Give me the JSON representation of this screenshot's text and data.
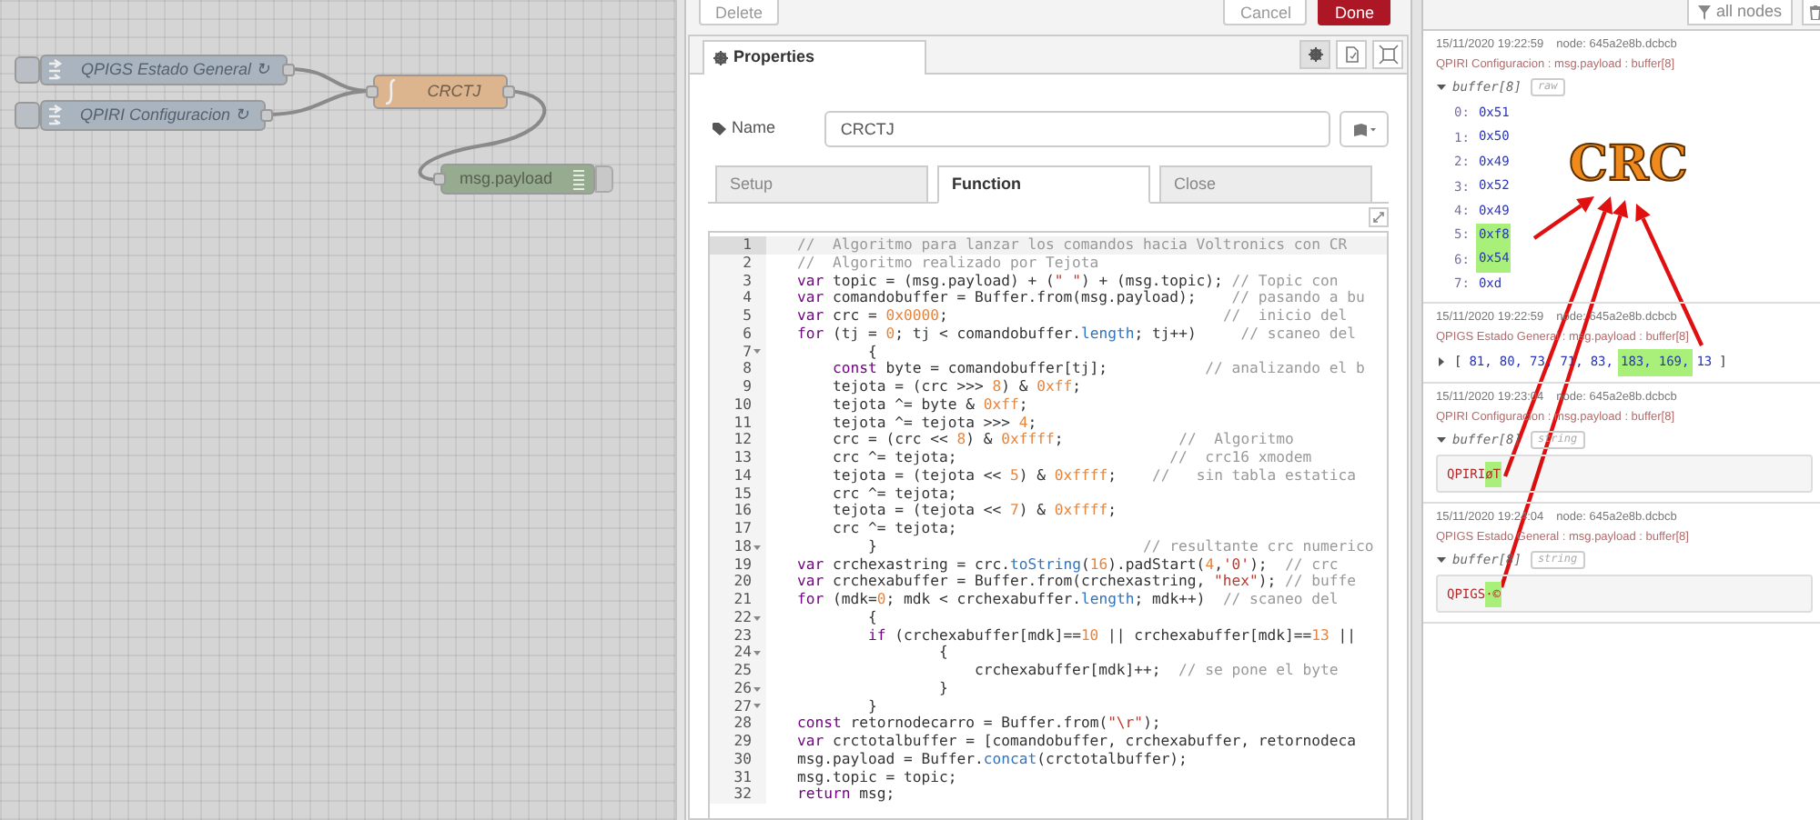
{
  "canvas": {
    "nodes": [
      {
        "kind": "inject",
        "label": "QPIGS Estado General ↻"
      },
      {
        "kind": "inject",
        "label": "QPIRI Configuracion ↻"
      },
      {
        "kind": "function",
        "label": "CRCTJ"
      },
      {
        "kind": "debug",
        "label": "msg.payload"
      }
    ]
  },
  "editor": {
    "buttons": [
      {
        "kind": "plain",
        "label": "Delete"
      },
      {
        "kind": "plain",
        "label": "Cancel"
      },
      {
        "kind": "primary",
        "label": "Done"
      }
    ],
    "panel_tab": "Properties",
    "panel_icons": [
      {
        "kind": "gear",
        "selected": true
      },
      {
        "kind": "document",
        "selected": false
      },
      {
        "kind": "frame",
        "selected": false
      }
    ],
    "name_label": "Name",
    "name_value": "CRCTJ",
    "tabs": [
      {
        "label": "Setup",
        "selected": false
      },
      {
        "label": "Function",
        "selected": true
      },
      {
        "label": "Close",
        "selected": false
      }
    ],
    "code_lines": [
      {
        "number": "1",
        "active": true,
        "foldable": false,
        "segments": [
          {
            "kind": "comment",
            "text": "//  Algoritmo para lanzar los comandos hacia Voltronics con CR"
          }
        ]
      },
      {
        "number": "2",
        "active": false,
        "foldable": false,
        "segments": [
          {
            "kind": "comment",
            "text": "//  Algoritmo realizado por Tejota"
          }
        ]
      },
      {
        "number": "3",
        "active": false,
        "foldable": false,
        "segments": [
          {
            "kind": "keyword",
            "text": "var"
          },
          {
            "text": " topic = (msg.payload) + ("
          },
          {
            "kind": "string",
            "text": "\" \""
          },
          {
            "text": ") + (msg.topic); "
          },
          {
            "kind": "comment",
            "text": "// Topic con"
          }
        ]
      },
      {
        "number": "4",
        "active": false,
        "foldable": false,
        "segments": [
          {
            "kind": "keyword",
            "text": "var"
          },
          {
            "text": " comandobuffer = Buffer.from(msg.payload);    "
          },
          {
            "kind": "comment",
            "text": "// pasando a bu"
          }
        ]
      },
      {
        "number": "5",
        "active": false,
        "foldable": false,
        "segments": [
          {
            "kind": "keyword",
            "text": "var"
          },
          {
            "text": " crc = "
          },
          {
            "kind": "number",
            "text": "0x0000"
          },
          {
            "text": ";                               "
          },
          {
            "kind": "comment",
            "text": "//  inicio del"
          }
        ]
      },
      {
        "number": "6",
        "active": false,
        "foldable": false,
        "segments": [
          {
            "kind": "keyword",
            "text": "for"
          },
          {
            "text": " (tj = "
          },
          {
            "kind": "number",
            "text": "0"
          },
          {
            "text": "; tj < comandobuffer."
          },
          {
            "kind": "property",
            "text": "length"
          },
          {
            "text": "; tj++)     "
          },
          {
            "kind": "comment",
            "text": "// scaneo del"
          }
        ]
      },
      {
        "number": "7",
        "active": false,
        "foldable": true,
        "segments": [
          {
            "text": "        {"
          }
        ]
      },
      {
        "number": "8",
        "active": false,
        "foldable": false,
        "segments": [
          {
            "kind": "keyword",
            "text": "    const"
          },
          {
            "text": " byte = comandobuffer[tj];           "
          },
          {
            "kind": "comment",
            "text": "// analizando el b"
          }
        ]
      },
      {
        "number": "9",
        "active": false,
        "foldable": false,
        "segments": [
          {
            "text": "    tejota = (crc >>> "
          },
          {
            "kind": "number",
            "text": "8"
          },
          {
            "text": ") & "
          },
          {
            "kind": "number",
            "text": "0xff"
          },
          {
            "text": ";"
          }
        ]
      },
      {
        "number": "10",
        "active": false,
        "foldable": false,
        "segments": [
          {
            "text": "    tejota ^= byte & "
          },
          {
            "kind": "number",
            "text": "0xff"
          },
          {
            "text": ";"
          }
        ]
      },
      {
        "number": "11",
        "active": false,
        "foldable": false,
        "segments": [
          {
            "text": "    tejota ^= tejota >>> "
          },
          {
            "kind": "number",
            "text": "4"
          },
          {
            "text": ";"
          }
        ]
      },
      {
        "number": "12",
        "active": false,
        "foldable": false,
        "segments": [
          {
            "text": "    crc = (crc << "
          },
          {
            "kind": "number",
            "text": "8"
          },
          {
            "text": ") & "
          },
          {
            "kind": "number",
            "text": "0xffff"
          },
          {
            "text": ";             "
          },
          {
            "kind": "comment",
            "text": "//  Algoritmo"
          }
        ]
      },
      {
        "number": "13",
        "active": false,
        "foldable": false,
        "segments": [
          {
            "text": "    crc ^= tejota;                        "
          },
          {
            "kind": "comment",
            "text": "//  crc16 xmodem"
          }
        ]
      },
      {
        "number": "14",
        "active": false,
        "foldable": false,
        "segments": [
          {
            "text": "    tejota = (tejota << "
          },
          {
            "kind": "number",
            "text": "5"
          },
          {
            "text": ") & "
          },
          {
            "kind": "number",
            "text": "0xffff"
          },
          {
            "text": ";    "
          },
          {
            "kind": "comment",
            "text": "//   sin tabla estatica"
          }
        ]
      },
      {
        "number": "15",
        "active": false,
        "foldable": false,
        "segments": [
          {
            "text": "    crc ^= tejota;"
          }
        ]
      },
      {
        "number": "16",
        "active": false,
        "foldable": false,
        "segments": [
          {
            "text": "    tejota = (tejota << "
          },
          {
            "kind": "number",
            "text": "7"
          },
          {
            "text": ") & "
          },
          {
            "kind": "number",
            "text": "0xffff"
          },
          {
            "text": ";"
          }
        ]
      },
      {
        "number": "17",
        "active": false,
        "foldable": false,
        "segments": [
          {
            "text": "    crc ^= tejota;"
          }
        ]
      },
      {
        "number": "18",
        "active": false,
        "foldable": true,
        "segments": [
          {
            "text": "        }                              "
          },
          {
            "kind": "comment",
            "text": "// resultante crc numerico"
          }
        ]
      },
      {
        "number": "19",
        "active": false,
        "foldable": false,
        "segments": [
          {
            "kind": "keyword",
            "text": "var"
          },
          {
            "text": " crchexastring = crc."
          },
          {
            "kind": "property",
            "text": "toString"
          },
          {
            "text": "("
          },
          {
            "kind": "number",
            "text": "16"
          },
          {
            "text": ").padStart("
          },
          {
            "kind": "number",
            "text": "4"
          },
          {
            "text": ","
          },
          {
            "kind": "string",
            "text": "'0'"
          },
          {
            "text": ");  "
          },
          {
            "kind": "comment",
            "text": "// crc"
          }
        ]
      },
      {
        "number": "20",
        "active": false,
        "foldable": false,
        "segments": [
          {
            "kind": "keyword",
            "text": "var"
          },
          {
            "text": " crchexabuffer = Buffer.from(crchexastring, "
          },
          {
            "kind": "string",
            "text": "\"hex\""
          },
          {
            "text": "); "
          },
          {
            "kind": "comment",
            "text": "// buffe"
          }
        ]
      },
      {
        "number": "21",
        "active": false,
        "foldable": false,
        "segments": [
          {
            "kind": "keyword",
            "text": "for"
          },
          {
            "text": " (mdk="
          },
          {
            "kind": "number",
            "text": "0"
          },
          {
            "text": "; mdk < crchexabuffer."
          },
          {
            "kind": "property",
            "text": "length"
          },
          {
            "text": "; mdk++)  "
          },
          {
            "kind": "comment",
            "text": "// scaneo del"
          }
        ]
      },
      {
        "number": "22",
        "active": false,
        "foldable": true,
        "segments": [
          {
            "text": "        {"
          }
        ]
      },
      {
        "number": "23",
        "active": false,
        "foldable": false,
        "segments": [
          {
            "kind": "keyword",
            "text": "        if"
          },
          {
            "text": " (crchexabuffer[mdk]=="
          },
          {
            "kind": "number",
            "text": "10"
          },
          {
            "text": " || crchexabuffer[mdk]=="
          },
          {
            "kind": "number",
            "text": "13"
          },
          {
            "text": " ||"
          }
        ]
      },
      {
        "number": "24",
        "active": false,
        "foldable": true,
        "segments": [
          {
            "text": "                {"
          }
        ]
      },
      {
        "number": "25",
        "active": false,
        "foldable": false,
        "segments": [
          {
            "text": "                    crchexabuffer[mdk]++;  "
          },
          {
            "kind": "comment",
            "text": "// se pone el byte"
          }
        ]
      },
      {
        "number": "26",
        "active": false,
        "foldable": true,
        "segments": [
          {
            "text": "                }"
          }
        ]
      },
      {
        "number": "27",
        "active": false,
        "foldable": true,
        "segments": [
          {
            "text": "        }"
          }
        ]
      },
      {
        "number": "28",
        "active": false,
        "foldable": false,
        "segments": [
          {
            "kind": "keyword",
            "text": "const"
          },
          {
            "text": " retornodecarro = Buffer.from("
          },
          {
            "kind": "string",
            "text": "\"\\r\""
          },
          {
            "text": ");"
          }
        ]
      },
      {
        "number": "29",
        "active": false,
        "foldable": false,
        "segments": [
          {
            "kind": "keyword",
            "text": "var"
          },
          {
            "text": " crctotalbuffer = [comandobuffer, crchexabuffer, retornodeca"
          }
        ]
      },
      {
        "number": "30",
        "active": false,
        "foldable": false,
        "segments": [
          {
            "text": "msg.payload = Buffer."
          },
          {
            "kind": "property",
            "text": "concat"
          },
          {
            "text": "(crctotalbuffer);"
          }
        ]
      },
      {
        "number": "31",
        "active": false,
        "foldable": false,
        "segments": [
          {
            "text": "msg.topic = topic;"
          }
        ]
      },
      {
        "number": "32",
        "active": false,
        "foldable": false,
        "segments": [
          {
            "kind": "keyword",
            "text": "return"
          },
          {
            "text": " msg;"
          }
        ]
      }
    ]
  },
  "debug": {
    "filter_button": "all nodes",
    "messages": [
      {
        "kind": "object",
        "date": "15/11/2020 19:22:59",
        "node": "node: 645a2e8b.dcbcb",
        "topic": "QPIRI Configuracion : msg.payload : buffer[8]",
        "expanded": true,
        "type_label": "buffer[8]",
        "format": "raw",
        "items": [
          {
            "index": "0:",
            "value": "0x51",
            "highlighted": false
          },
          {
            "index": "1:",
            "value": "0x50",
            "highlighted": false
          },
          {
            "index": "2:",
            "value": "0x49",
            "highlighted": false
          },
          {
            "index": "3:",
            "value": "0x52",
            "highlighted": false
          },
          {
            "index": "4:",
            "value": "0x49",
            "highlighted": false
          },
          {
            "index": "5:",
            "value": "0xf8",
            "highlighted": true
          },
          {
            "index": "6:",
            "value": "0x54",
            "highlighted": true
          },
          {
            "index": "7:",
            "value": "0xd",
            "highlighted": false
          }
        ]
      },
      {
        "kind": "array",
        "date": "15/11/2020 19:22:59",
        "node": "node: 645a2e8b.dcbcb",
        "topic": "QPIGS Estado General : msg.payload : buffer[8]",
        "expanded": false,
        "open": "[",
        "close": "]",
        "values": [
          {
            "text": "81,",
            "highlighted": false
          },
          {
            "text": "80,",
            "highlighted": false
          },
          {
            "text": "73,",
            "highlighted": false
          },
          {
            "text": "71,",
            "highlighted": false
          },
          {
            "text": "83,",
            "highlighted": false
          },
          {
            "text": "183,",
            "highlighted": true
          },
          {
            "text": "169,",
            "highlighted": true
          },
          {
            "text": "13",
            "highlighted": false
          }
        ]
      },
      {
        "kind": "string",
        "date": "15/11/2020 19:23:04",
        "node": "node: 645a2e8b.dcbcb",
        "topic": "QPIRI Configuracion : msg.payload : buffer[8]",
        "expanded": true,
        "type_label": "buffer[8]",
        "format": "string",
        "parts": [
          {
            "text": "QPIRI",
            "highlighted": false
          },
          {
            "text": "øT",
            "highlighted": true
          }
        ]
      },
      {
        "kind": "string",
        "date": "15/11/2020 19:24:04",
        "node": "node: 645a2e8b.dcbcb",
        "topic": "QPIGS Estado General : msg.payload : buffer[8]",
        "expanded": true,
        "type_label": "buffer[8]",
        "format": "string",
        "parts": [
          {
            "text": "QPIGS",
            "highlighted": false
          },
          {
            "text": "·©",
            "highlighted": true
          }
        ]
      }
    ]
  },
  "annotation": {
    "label": "CRC"
  }
}
